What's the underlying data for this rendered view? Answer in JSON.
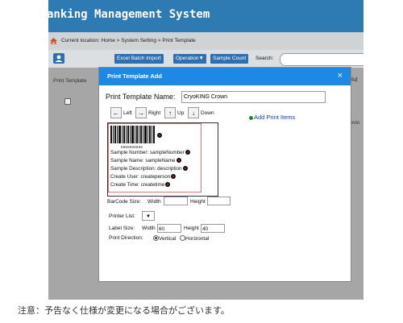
{
  "app": {
    "title": "anking Management System"
  },
  "breadcrumb": {
    "text": "Current location: Home > System Setting > Print Template"
  },
  "toolbar": {
    "excel_label": "Excel Batch Import",
    "operation_label": "Operation▼",
    "sample_count_label": "Sample Count",
    "search_label": "Search:",
    "search_value": ""
  },
  "list": {
    "column_header": "Print Template",
    "right_text_a": "Ad",
    "right_text_b": "Previo"
  },
  "dialog": {
    "title": "Print Template Add",
    "close_glyph": "×",
    "name_label": "Print Template Name:",
    "name_value": "CryoKING Crown",
    "nav": {
      "left_glyph": "←",
      "left_label": "Left",
      "right_glyph": "→",
      "right_label": "Right",
      "up_glyph": "↑",
      "up_label": "Up",
      "down_glyph": "↓",
      "down_label": "Down"
    },
    "add_items_label": "Add Print Items",
    "preview": {
      "barcode_number": "6666666666",
      "fields": [
        "Sample Number: sampleNumber",
        "Sample Name: sampleName",
        "Sample Description: description",
        "Create User: createperson",
        "Create Time: createtime"
      ]
    },
    "barcode_size_label": "BarCode Size:",
    "barcode_width_label": "Width",
    "barcode_width_value": "",
    "barcode_height_label": "Height",
    "barcode_height_value": "",
    "printer_list_label": "Printer List:",
    "printer_selected": "▼",
    "label_size_label": "Label Size:",
    "label_width_label": "Width",
    "label_width_value": "60",
    "label_height_label": "Height",
    "label_height_value": "40",
    "direction_label": "Print Direction:",
    "direction_vertical": "Vertical",
    "direction_horizontal": "Horizontal"
  },
  "footer_note": "注意：予告なく仕様が変更になる場合がございます。",
  "colors": {
    "header_blue": "#2e7ab3",
    "dialog_header": "#1e88e5",
    "link_blue": "#1a3aa6"
  }
}
